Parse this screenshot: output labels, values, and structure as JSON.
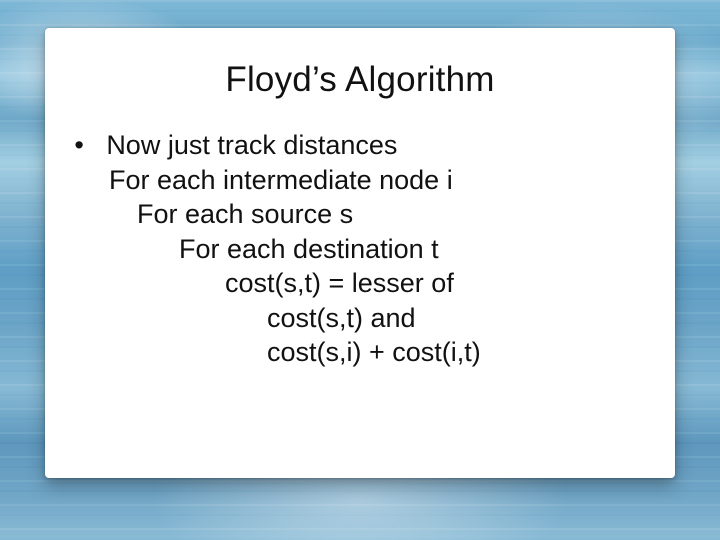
{
  "slide": {
    "title": "Floyd’s Algorithm",
    "bullet_glyph": "•",
    "lines": {
      "l0": "Now just track distances",
      "l1": "For each intermediate node i",
      "l2": "For each source s",
      "l3": "For each destination t",
      "l4": "cost(s,t) = lesser of",
      "l5": "cost(s,t) and",
      "l6": "cost(s,i) + cost(i,t)"
    }
  }
}
